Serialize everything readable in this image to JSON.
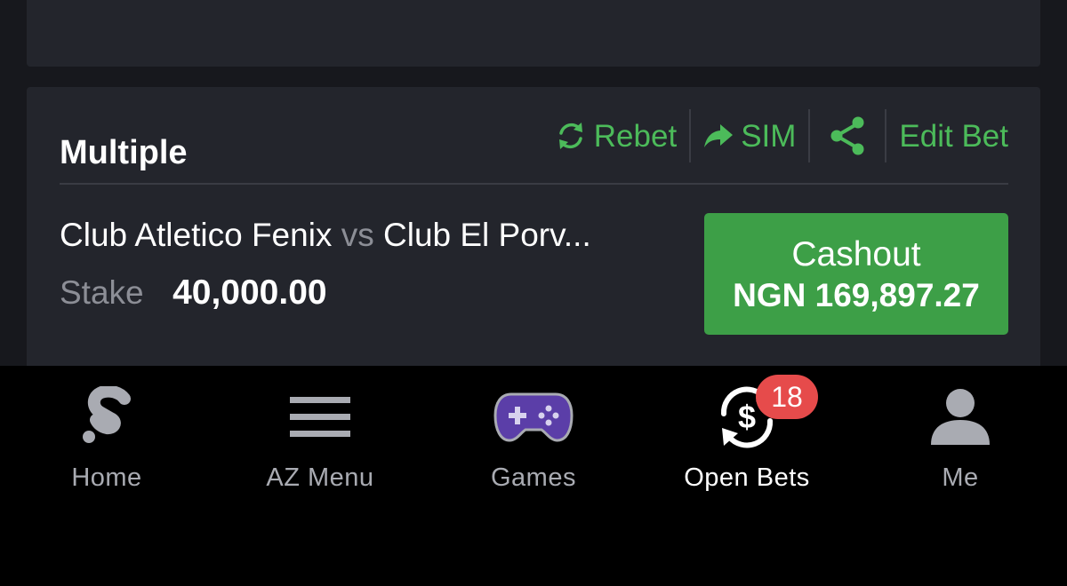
{
  "bet": {
    "title": "Multiple",
    "actions": {
      "rebet": "Rebet",
      "sim": "SIM",
      "edit_bet": "Edit Bet"
    },
    "match": {
      "home": "Club Atletico Fenix",
      "vs": "vs",
      "away": "Club El Porv..."
    },
    "stake": {
      "label": "Stake",
      "value": "40,000.00"
    },
    "cashout": {
      "label": "Cashout",
      "amount": "NGN 169,897.27"
    }
  },
  "tabbar": {
    "items": [
      {
        "label": "Home",
        "icon": "sportybet-logo-icon"
      },
      {
        "label": "AZ Menu",
        "icon": "hamburger-menu-icon"
      },
      {
        "label": "Games",
        "icon": "gamepad-icon"
      },
      {
        "label": "Open Bets",
        "icon": "dollar-cycle-icon",
        "badge": "18",
        "active": true
      },
      {
        "label": "Me",
        "icon": "user-icon"
      }
    ]
  },
  "colors": {
    "accent_green": "#4cbb5a",
    "cashout_green": "#3d9f47",
    "badge_red": "#e64b4b",
    "games_purple": "#5b3ea8"
  }
}
